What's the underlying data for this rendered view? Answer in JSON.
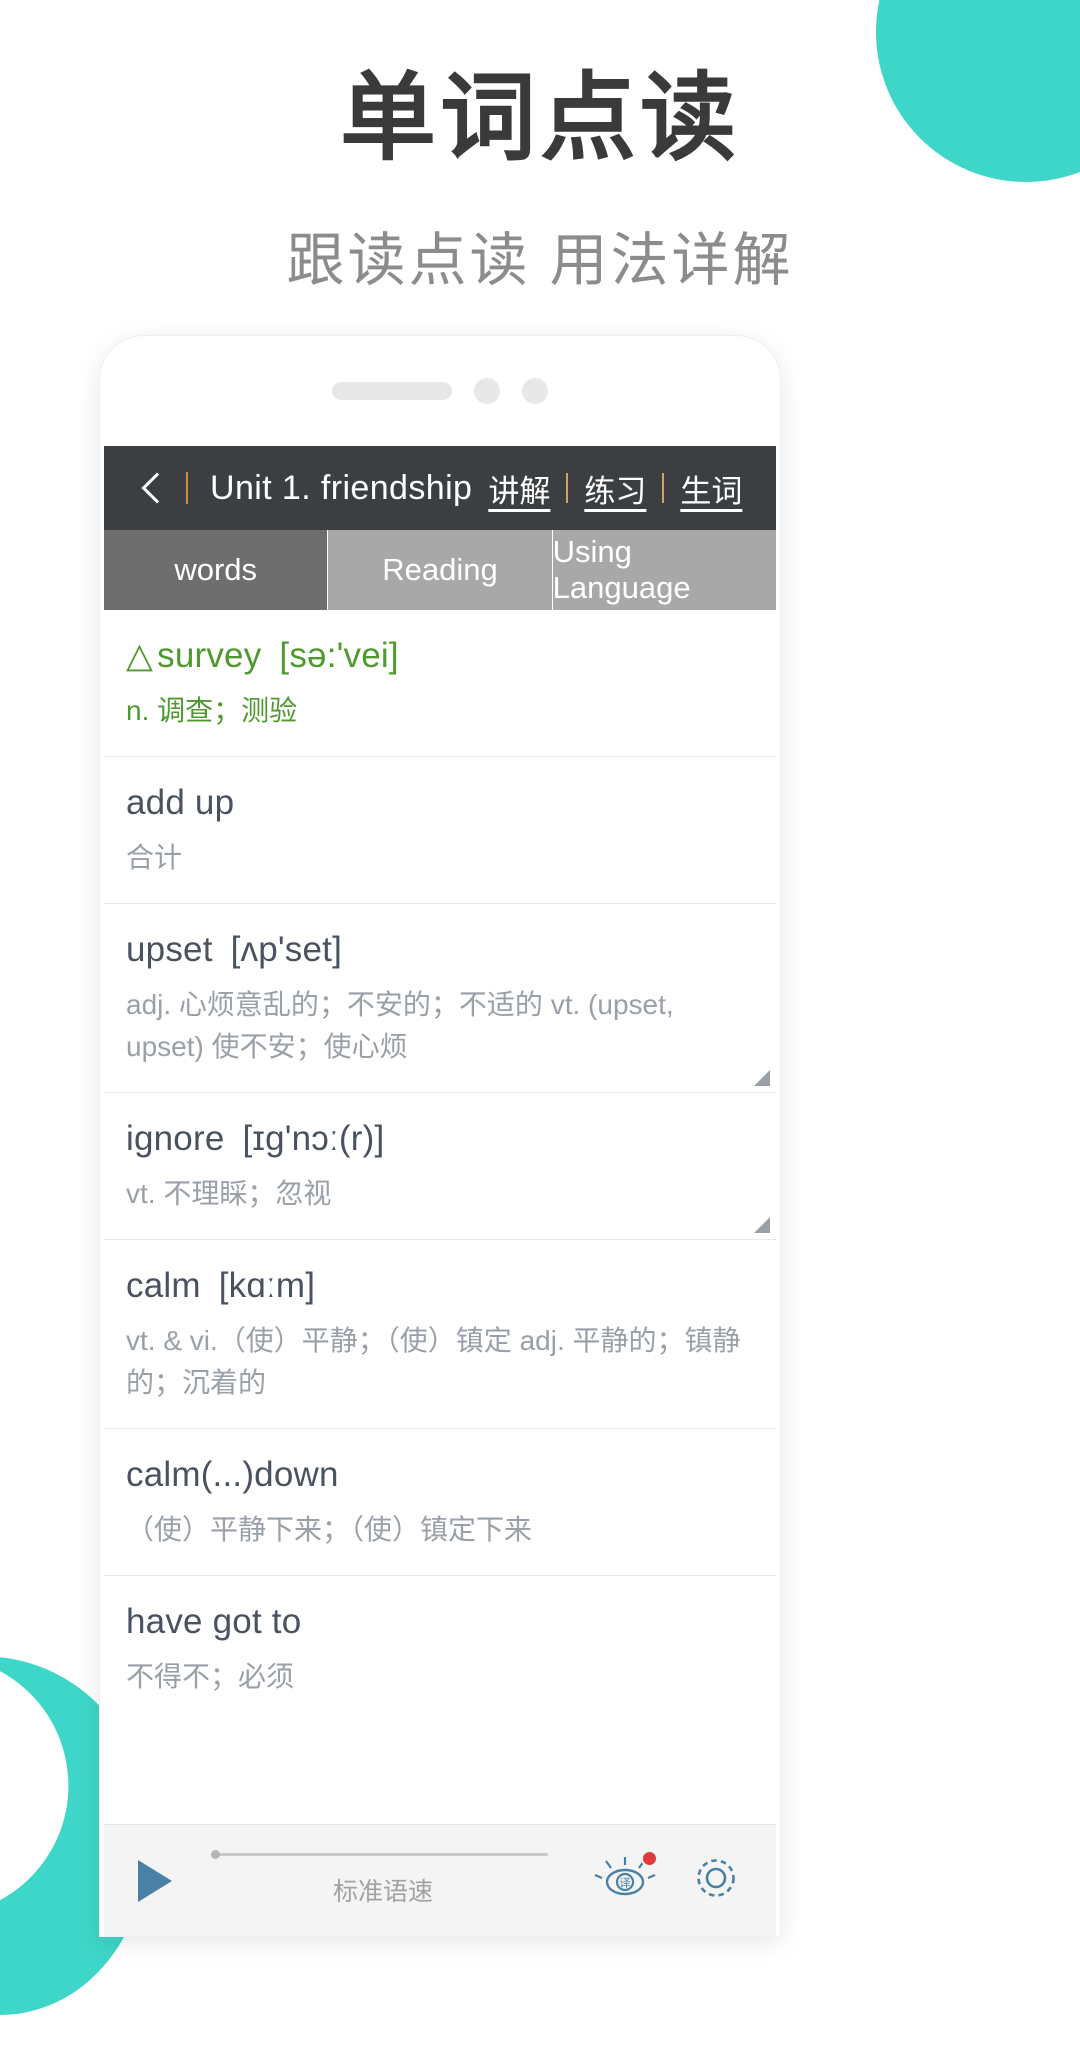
{
  "promo": {
    "title": "单词点读",
    "subtitle": "跟读点读 用法详解",
    "accent_color": "#3ed6c8"
  },
  "phone": {
    "speaker_icon": "speaker-grill",
    "camera_icon": "camera-dot"
  },
  "app": {
    "header": {
      "back_icon": "back-chevron-icon",
      "unit_title": "Unit 1. friendship",
      "links": [
        {
          "label": "讲解"
        },
        {
          "label": "练习"
        },
        {
          "label": "生词"
        }
      ]
    },
    "tabs": [
      {
        "label": "words",
        "active": true
      },
      {
        "label": "Reading",
        "active": false
      },
      {
        "label": "Using Language",
        "active": false
      }
    ],
    "words": [
      {
        "marker": "△",
        "word": "survey",
        "phonetic": "[sə:'vei]",
        "definition": "n. 调查；测验",
        "highlight": true,
        "resize_corner": false
      },
      {
        "marker": "",
        "word": "add up",
        "phonetic": "",
        "definition": "合计",
        "highlight": false,
        "resize_corner": false
      },
      {
        "marker": "",
        "word": "upset",
        "phonetic": "[ʌp'set]",
        "definition": "adj. 心烦意乱的；不安的；不适的 vt. (upset, upset) 使不安；使心烦",
        "highlight": false,
        "resize_corner": true
      },
      {
        "marker": "",
        "word": "ignore",
        "phonetic": "[ɪg'nɔː(r)]",
        "definition": "vt. 不理睬；忽视",
        "highlight": false,
        "resize_corner": true
      },
      {
        "marker": "",
        "word": "calm",
        "phonetic": "[kɑːm]",
        "definition": "vt. & vi.（使）平静；（使）镇定 adj. 平静的；镇静的；沉着的",
        "highlight": false,
        "resize_corner": false
      },
      {
        "marker": "",
        "word": "calm(...)down",
        "phonetic": "",
        "definition": "（使）平静下来；（使）镇定下来",
        "highlight": false,
        "resize_corner": false
      },
      {
        "marker": "",
        "word": "have got to",
        "phonetic": "",
        "definition": "不得不；必须",
        "highlight": false,
        "resize_corner": false
      }
    ],
    "player": {
      "play_icon": "play-icon",
      "speed_label": "标准语速",
      "translate_icon": "translate-eye-icon",
      "translate_badge": true,
      "settings_icon": "gear-icon"
    }
  }
}
